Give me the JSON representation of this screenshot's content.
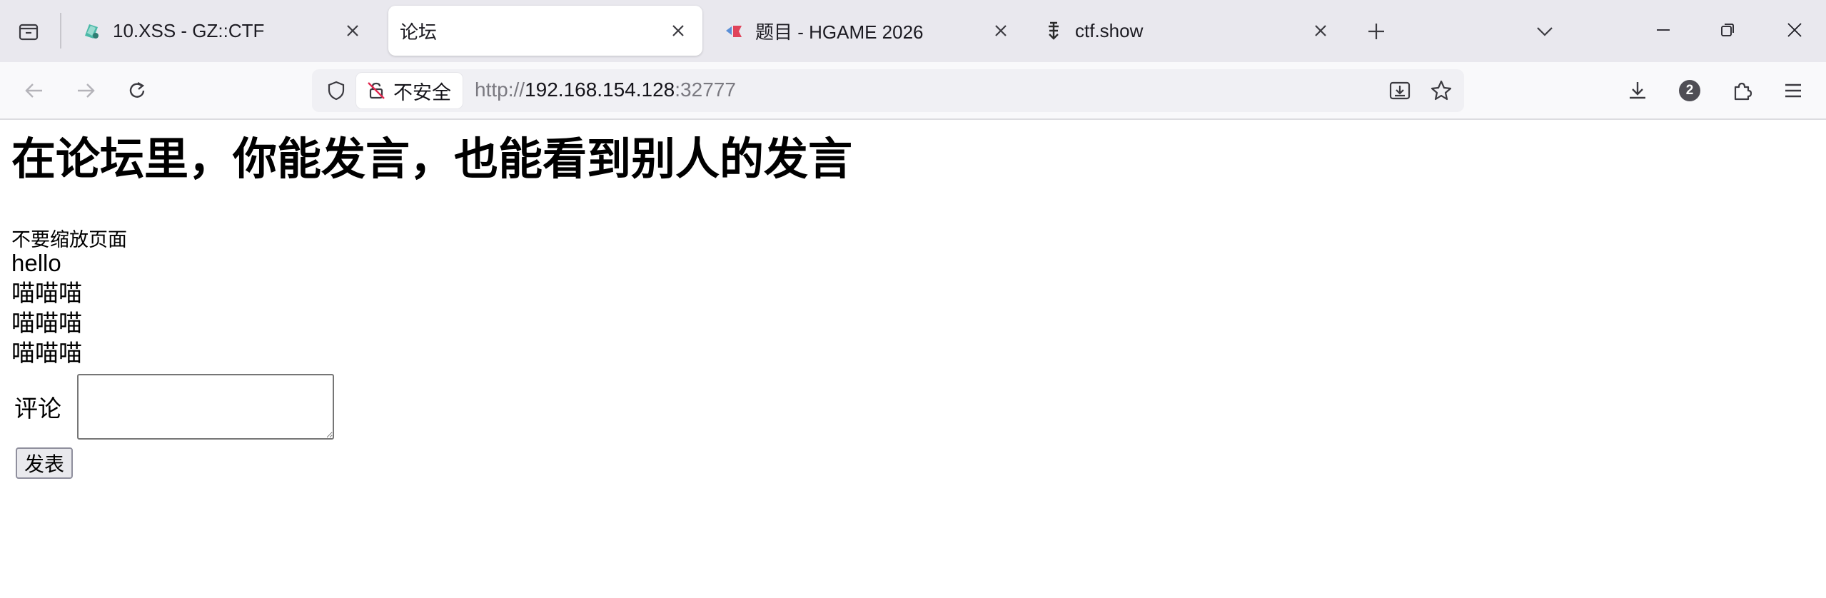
{
  "browser": {
    "tabs": [
      {
        "title": "10.XSS - GZ::CTF",
        "active": false
      },
      {
        "title": "论坛",
        "active": true
      },
      {
        "title": "题目 - HGAME 2026",
        "active": false
      },
      {
        "title": "ctf.show",
        "active": false
      }
    ],
    "urlbar": {
      "security_label": "不安全",
      "url_protocol": "http://",
      "url_host": "192.168.154.128",
      "url_port": ":32777"
    },
    "extensions_badge": "2"
  },
  "page": {
    "heading": "在论坛里，你能发言，也能看到别人的发言",
    "hint": "不要缩放页面",
    "posts": [
      "hello",
      "喵喵喵",
      "喵喵喵",
      "喵喵喵"
    ],
    "comment_label": "评论",
    "comment_value": "",
    "submit_label": "发表"
  },
  "colors": {
    "tabbar_bg": "#e9e8ee",
    "toolbar_bg": "#f9f9fb",
    "urlbar_bg": "#f0f0f4",
    "text": "#000000",
    "muted_url": "#7a7980"
  }
}
